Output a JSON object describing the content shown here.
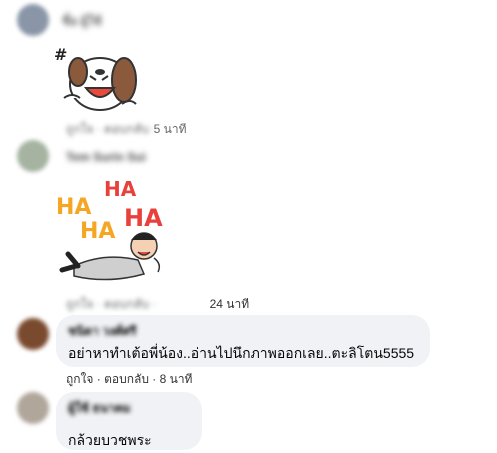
{
  "comments": [
    {
      "author": "ณัฐ ธนวัฒน์",
      "sticker": "laughing-dog-sticker",
      "time": "5 นาที",
      "actions": "ถูกใจ · ตอบกลับ ·"
    },
    {
      "author": "Tem Surin Sui",
      "sticker": "haha-laughing-man-sticker",
      "time": "24 นาที",
      "actions": "ถูกใจ · ตอบกลับ ·"
    },
    {
      "author": "ชนิดา วงศ์ศรี",
      "text": "อย่าหาทำเต้อพี่น้อง..อ่านไปนึกภาพออกเลย..ตะลิโตน5555",
      "actions": "ถูกใจ · ตอบกลับ · 8 นาที"
    },
    {
      "author": "ผู้ใช้ ธนาคม",
      "text": "กล้วยบวชพระ"
    }
  ],
  "sticker_text": [
    "HA",
    "HA",
    "HA",
    "HA"
  ],
  "colors": {
    "bubble": "#f0f2f5",
    "meta": "#65676b",
    "ha_orange": "#f5a623",
    "ha_red": "#e8413c"
  }
}
